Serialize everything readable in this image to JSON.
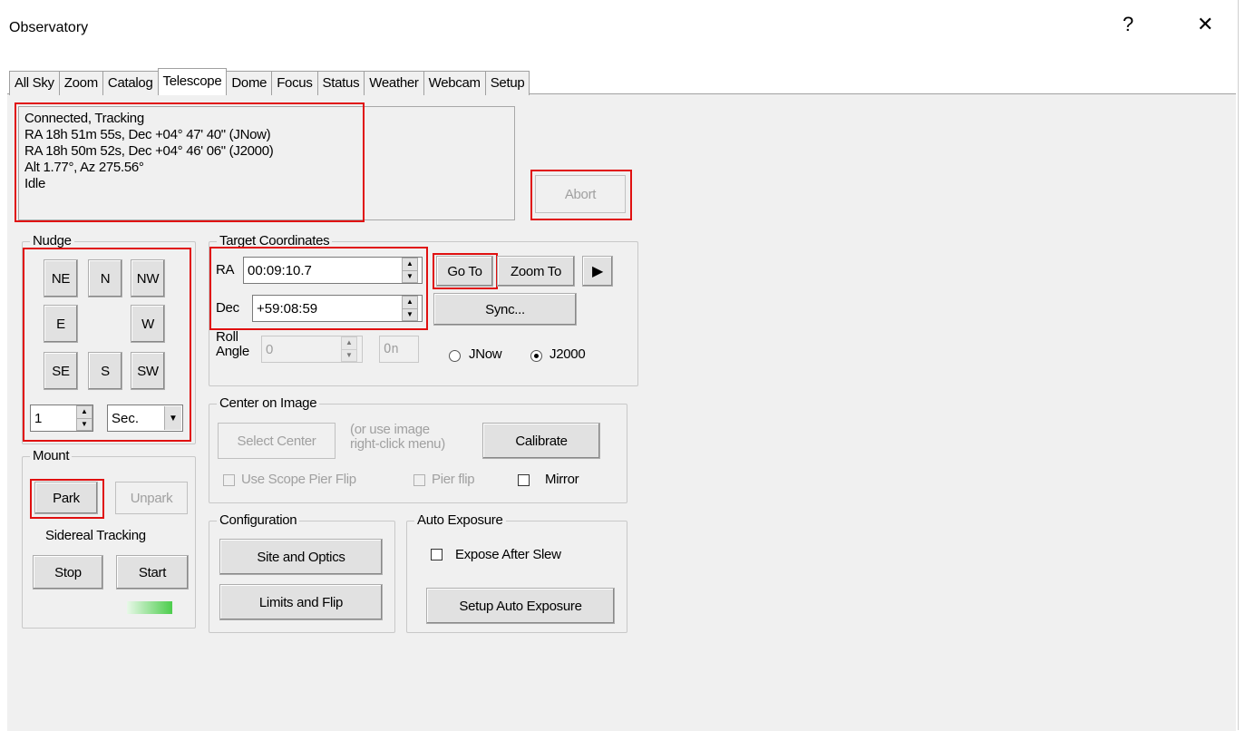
{
  "window": {
    "title": "Observatory",
    "help_glyph": "?",
    "close_glyph": "✕"
  },
  "tabs": [
    "All Sky",
    "Zoom",
    "Catalog",
    "Telescope",
    "Dome",
    "Focus",
    "Status",
    "Weather",
    "Webcam",
    "Setup"
  ],
  "active_tab": "Telescope",
  "status": {
    "lines": [
      "Connected, Tracking",
      "RA 18h 51m 55s, Dec +04° 47' 40\" (JNow)",
      "RA 18h 50m 52s, Dec +04° 46' 06\" (J2000)",
      "Alt 1.77°, Az 275.56°",
      "Idle"
    ]
  },
  "abort_label": "Abort",
  "nudge": {
    "title": "Nudge",
    "ne": "NE",
    "n": "N",
    "nw": "NW",
    "e": "E",
    "w": "W",
    "se": "SE",
    "s": "S",
    "sw": "SW",
    "amount": "1",
    "unit": "Sec."
  },
  "mount": {
    "title": "Mount",
    "park": "Park",
    "unpark": "Unpark",
    "tracking_label": "Sidereal Tracking",
    "stop": "Stop",
    "start": "Start"
  },
  "target": {
    "title": "Target Coordinates",
    "ra_label": "RA",
    "ra_value": "00:09:10.7",
    "dec_label": "Dec",
    "dec_value": "+59:08:59",
    "goto": "Go To",
    "zoomto": "Zoom To",
    "sync": "Sync...",
    "roll_label_1": "Roll",
    "roll_label_2": "Angle",
    "roll_value": "0",
    "on_label": "On",
    "jnow": "JNow",
    "j2000": "J2000",
    "epoch_selected": "J2000"
  },
  "center": {
    "title": "Center on Image",
    "select_center": "Select Center",
    "hint_1": "(or use image",
    "hint_2": "right-click menu)",
    "calibrate": "Calibrate",
    "use_pier_flip": "Use Scope Pier Flip",
    "pier_flip": "Pier flip",
    "mirror": "Mirror"
  },
  "configuration": {
    "title": "Configuration",
    "site_optics": "Site and Optics",
    "limits_flip": "Limits and Flip"
  },
  "auto_exposure": {
    "title": "Auto Exposure",
    "expose_after_slew": "Expose After Slew",
    "setup": "Setup Auto Exposure"
  },
  "colors": {
    "highlight": "#e01010",
    "tracking_led": "#4ccd4c"
  }
}
